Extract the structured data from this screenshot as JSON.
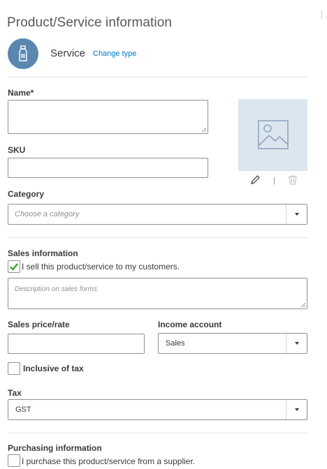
{
  "header": {
    "title": "Product/Service information"
  },
  "item_type": {
    "label": "Service",
    "change_link": "Change type",
    "icon": "bottle-icon"
  },
  "name": {
    "label": "Name*",
    "value": ""
  },
  "sku": {
    "label": "SKU",
    "value": ""
  },
  "image": {
    "icon": "image-placeholder-icon",
    "edit_icon": "pencil-icon",
    "delete_icon": "trash-icon",
    "separator": "|"
  },
  "category": {
    "label": "Category",
    "placeholder": "Choose a category"
  },
  "sales": {
    "heading": "Sales information",
    "sell_checkbox": {
      "label": "I sell this product/service to my customers.",
      "checked": true
    },
    "description_placeholder": "Description on sales forms",
    "price_label": "Sales price/rate",
    "price_value": "",
    "income_label": "Income account",
    "income_value": "Sales",
    "inclusive_tax": {
      "label": "Inclusive of tax",
      "checked": false
    },
    "tax_label": "Tax",
    "tax_value": "GST"
  },
  "purchasing": {
    "heading": "Purchasing information",
    "purchase_checkbox": {
      "label": "I purchase this product/service from a supplier.",
      "checked": false
    }
  },
  "colors": {
    "accent": "#0077c5",
    "check_green": "#2ca01c",
    "type_circle": "#5a87b0",
    "image_bg": "#dce6ef"
  }
}
